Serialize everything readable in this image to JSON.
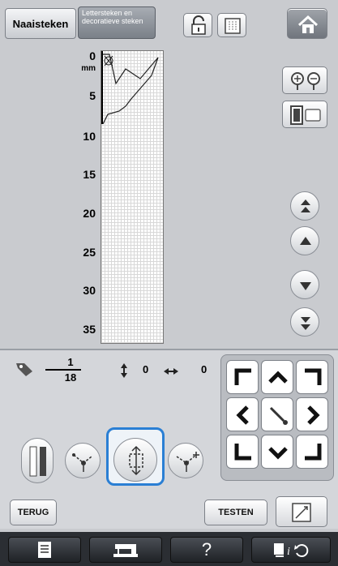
{
  "tabs": {
    "utility_label": "Naaisteken",
    "decorative_label": "Lettersteken en decoratieve steken"
  },
  "ruler": {
    "zero": "0",
    "unit": "mm",
    "marks": [
      "5",
      "10",
      "15",
      "20",
      "25",
      "30",
      "35"
    ]
  },
  "settings": {
    "density_numerator": "1",
    "density_denominator": "18",
    "vertical_value": "0",
    "horizontal_value": "0"
  },
  "buttons": {
    "back_label": "TERUG",
    "test_label": "TESTEN",
    "help_label": "?"
  },
  "colors": {
    "selection_highlight": "#2a7fd4",
    "bottom_bar": "#2b2e33",
    "background": "#c9cbcf"
  }
}
